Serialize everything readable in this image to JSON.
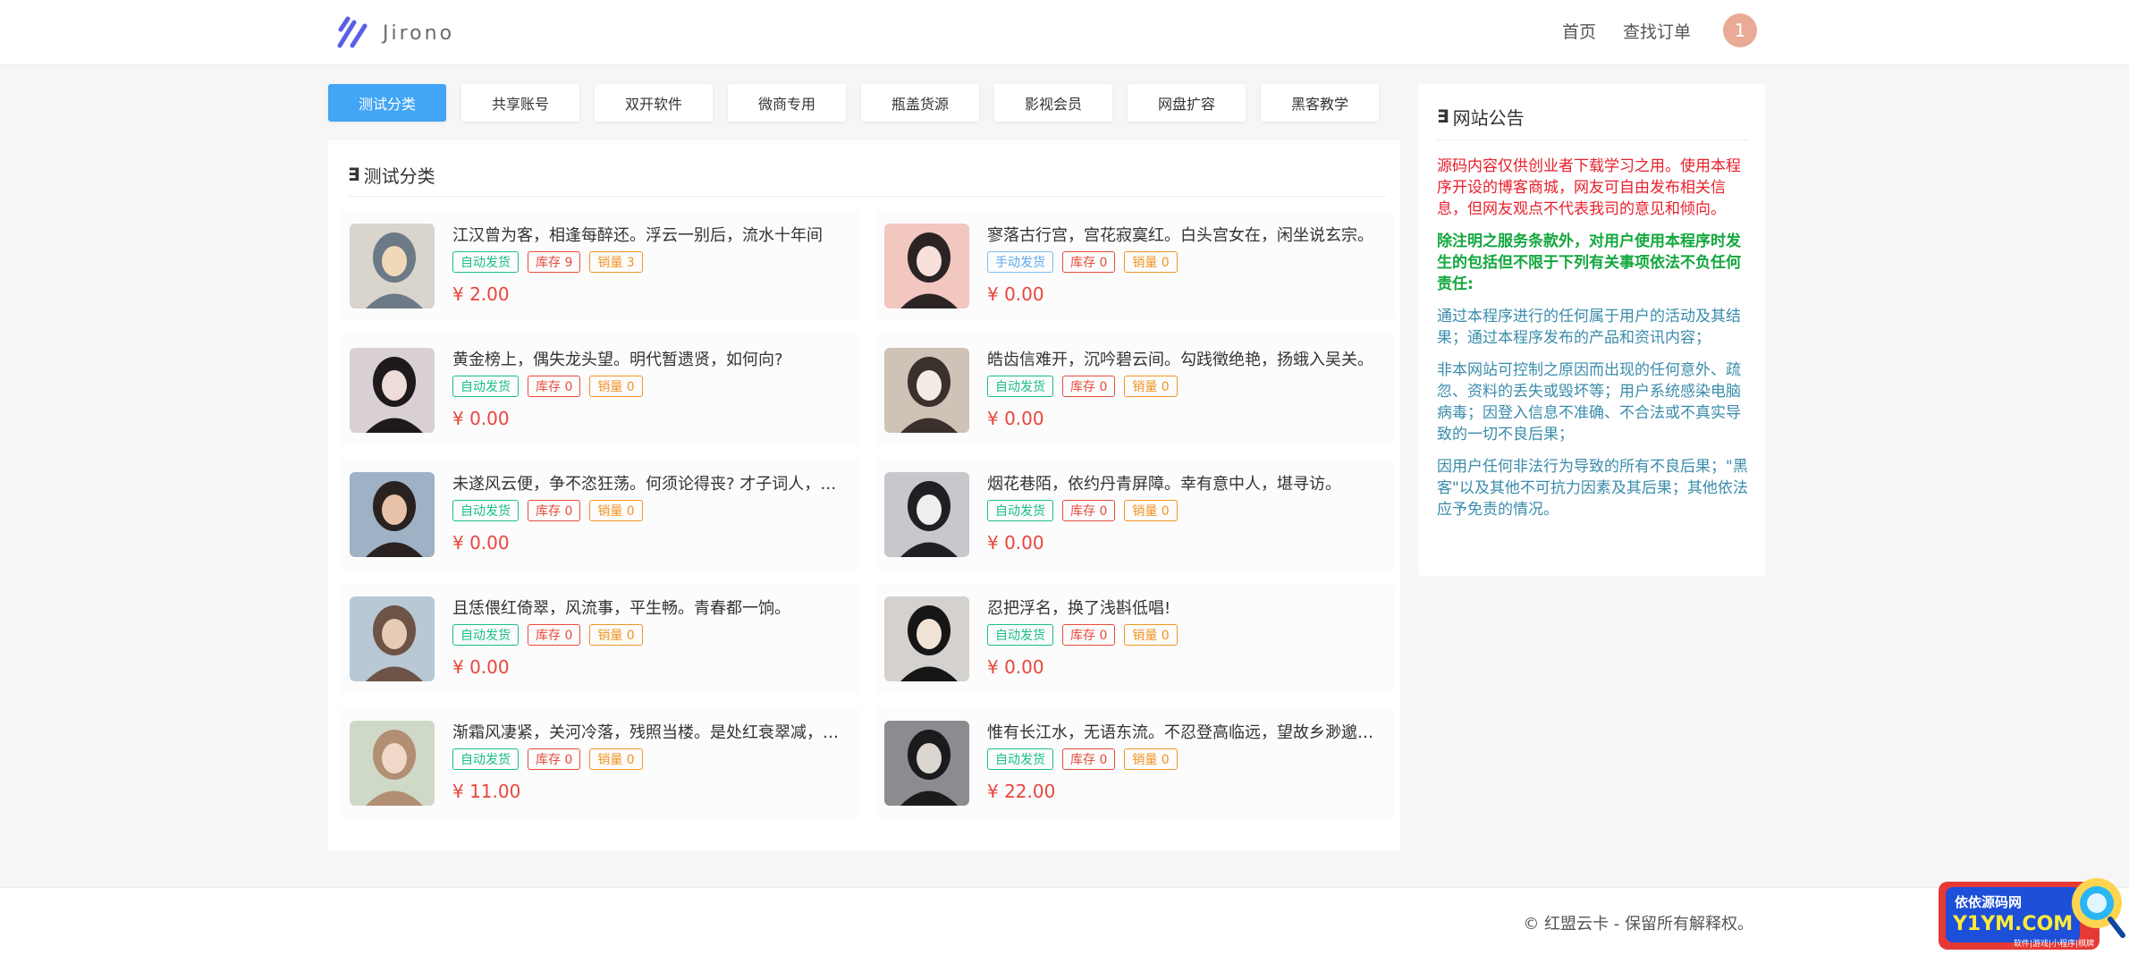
{
  "header": {
    "logo_text": "Jirono",
    "nav": [
      "首页",
      "查找订单"
    ],
    "user_badge": "1"
  },
  "tabs": [
    "测试分类",
    "共享账号",
    "双开软件",
    "微商专用",
    "瓶盖货源",
    "影视会员",
    "网盘扩容",
    "黑客教学"
  ],
  "active_tab": 0,
  "panel": {
    "title_mark": "∃",
    "title": "测试分类"
  },
  "products": [
    {
      "title": "江汉曾为客，相逢每醉还。浮云一别后，流水十年间",
      "delivery": "自动发货",
      "delivery_style": "green",
      "stock": "库存 9",
      "sales": "销量 3",
      "price": "¥ 2.00",
      "photo": "photo-girl-office"
    },
    {
      "title": "寥落古行宫，宫花寂寞红。白头宫女在，闲坐说玄宗。",
      "delivery": "手动发货",
      "delivery_style": "blue",
      "stock": "库存 0",
      "sales": "销量 0",
      "price": "¥ 0.00",
      "photo": "photo-girl-pink"
    },
    {
      "title": "黄金榜上，偶失龙头望。明代暂遗贤，如何向?",
      "delivery": "自动发货",
      "delivery_style": "green",
      "stock": "库存 0",
      "sales": "销量 0",
      "price": "¥ 0.00",
      "photo": "photo-girl-dark-hair"
    },
    {
      "title": "皓齿信难开，沉吟碧云间。勾践徵绝艳，扬蛾入吴关。",
      "delivery": "自动发货",
      "delivery_style": "green",
      "stock": "库存 0",
      "sales": "销量 0",
      "price": "¥ 0.00",
      "photo": "photo-girl-white-top"
    },
    {
      "title": "未遂风云便，争不恣狂荡。何须论得丧? 才子词人，自是白衣卿相",
      "delivery": "自动发货",
      "delivery_style": "green",
      "stock": "库存 0",
      "sales": "销量 0",
      "price": "¥ 0.00",
      "photo": "photo-girl-outdoor"
    },
    {
      "title": "烟花巷陌，依约丹青屏障。幸有意中人，堪寻访。",
      "delivery": "自动发货",
      "delivery_style": "green",
      "stock": "库存 0",
      "sales": "销量 0",
      "price": "¥ 0.00",
      "photo": "photo-girl-mask"
    },
    {
      "title": "且恁偎红倚翠，风流事，平生畅。青春都一饷。",
      "delivery": "自动发货",
      "delivery_style": "green",
      "stock": "库存 0",
      "sales": "销量 0",
      "price": "¥ 0.00",
      "photo": "photo-girl-beach"
    },
    {
      "title": "忍把浮名，换了浅斟低唱!",
      "delivery": "自动发货",
      "delivery_style": "green",
      "stock": "库存 0",
      "sales": "销量 0",
      "price": "¥ 0.00",
      "photo": "photo-girl-black-mask"
    },
    {
      "title": "渐霜风凄紧，关河冷落，残照当楼。是处红衰翠减，苒苒物华休",
      "delivery": "自动发货",
      "delivery_style": "green",
      "stock": "库存 0",
      "sales": "销量 0",
      "price": "¥ 11.00",
      "photo": "photo-girl-green-bg"
    },
    {
      "title": "惟有长江水，无语东流。不忍登高临远，望故乡渺邈，归思难收",
      "delivery": "自动发货",
      "delivery_style": "green",
      "stock": "库存 0",
      "sales": "销量 0",
      "price": "¥ 22.00",
      "photo": "photo-girl-window"
    }
  ],
  "notice": {
    "title_mark": "∃",
    "title": "网站公告",
    "p1": "源码内容仅供创业者下载学习之用。使用本程序开设的博客商城，网友可自由发布相关信息，但网友观点不代表我司的意见和倾向。",
    "p2": "除注明之服务条款外，对用户使用本程序时发生的包括但不限于下列有关事项依法不负任何责任:",
    "p3": "通过本程序进行的任何属于用户的活动及其结果；通过本程序发布的产品和资讯内容；",
    "p4": "非本网站可控制之原因而出现的任何意外、疏忽、资料的丢失或毁坏等；用户系统感染电脑病毒；因登入信息不准确、不合法或不真实导致的一切不良后果；",
    "p5": "因用户任何非法行为导致的所有不良后果；\"黑客\"以及其他不可抗力因素及其后果；其他依法应予免责的情况。"
  },
  "footer": {
    "copyright": "© 红盟云卡 - 保留所有解释权。"
  },
  "watermark": {
    "line1": "依依源码网",
    "line2": "Y1YM.COM",
    "line3": "软件|游戏|小程序|棋牌"
  },
  "colors": {
    "accent": "#42a5f5",
    "price": "#e8463d",
    "auto": "#19be8b",
    "manual": "#5aa9f0"
  }
}
